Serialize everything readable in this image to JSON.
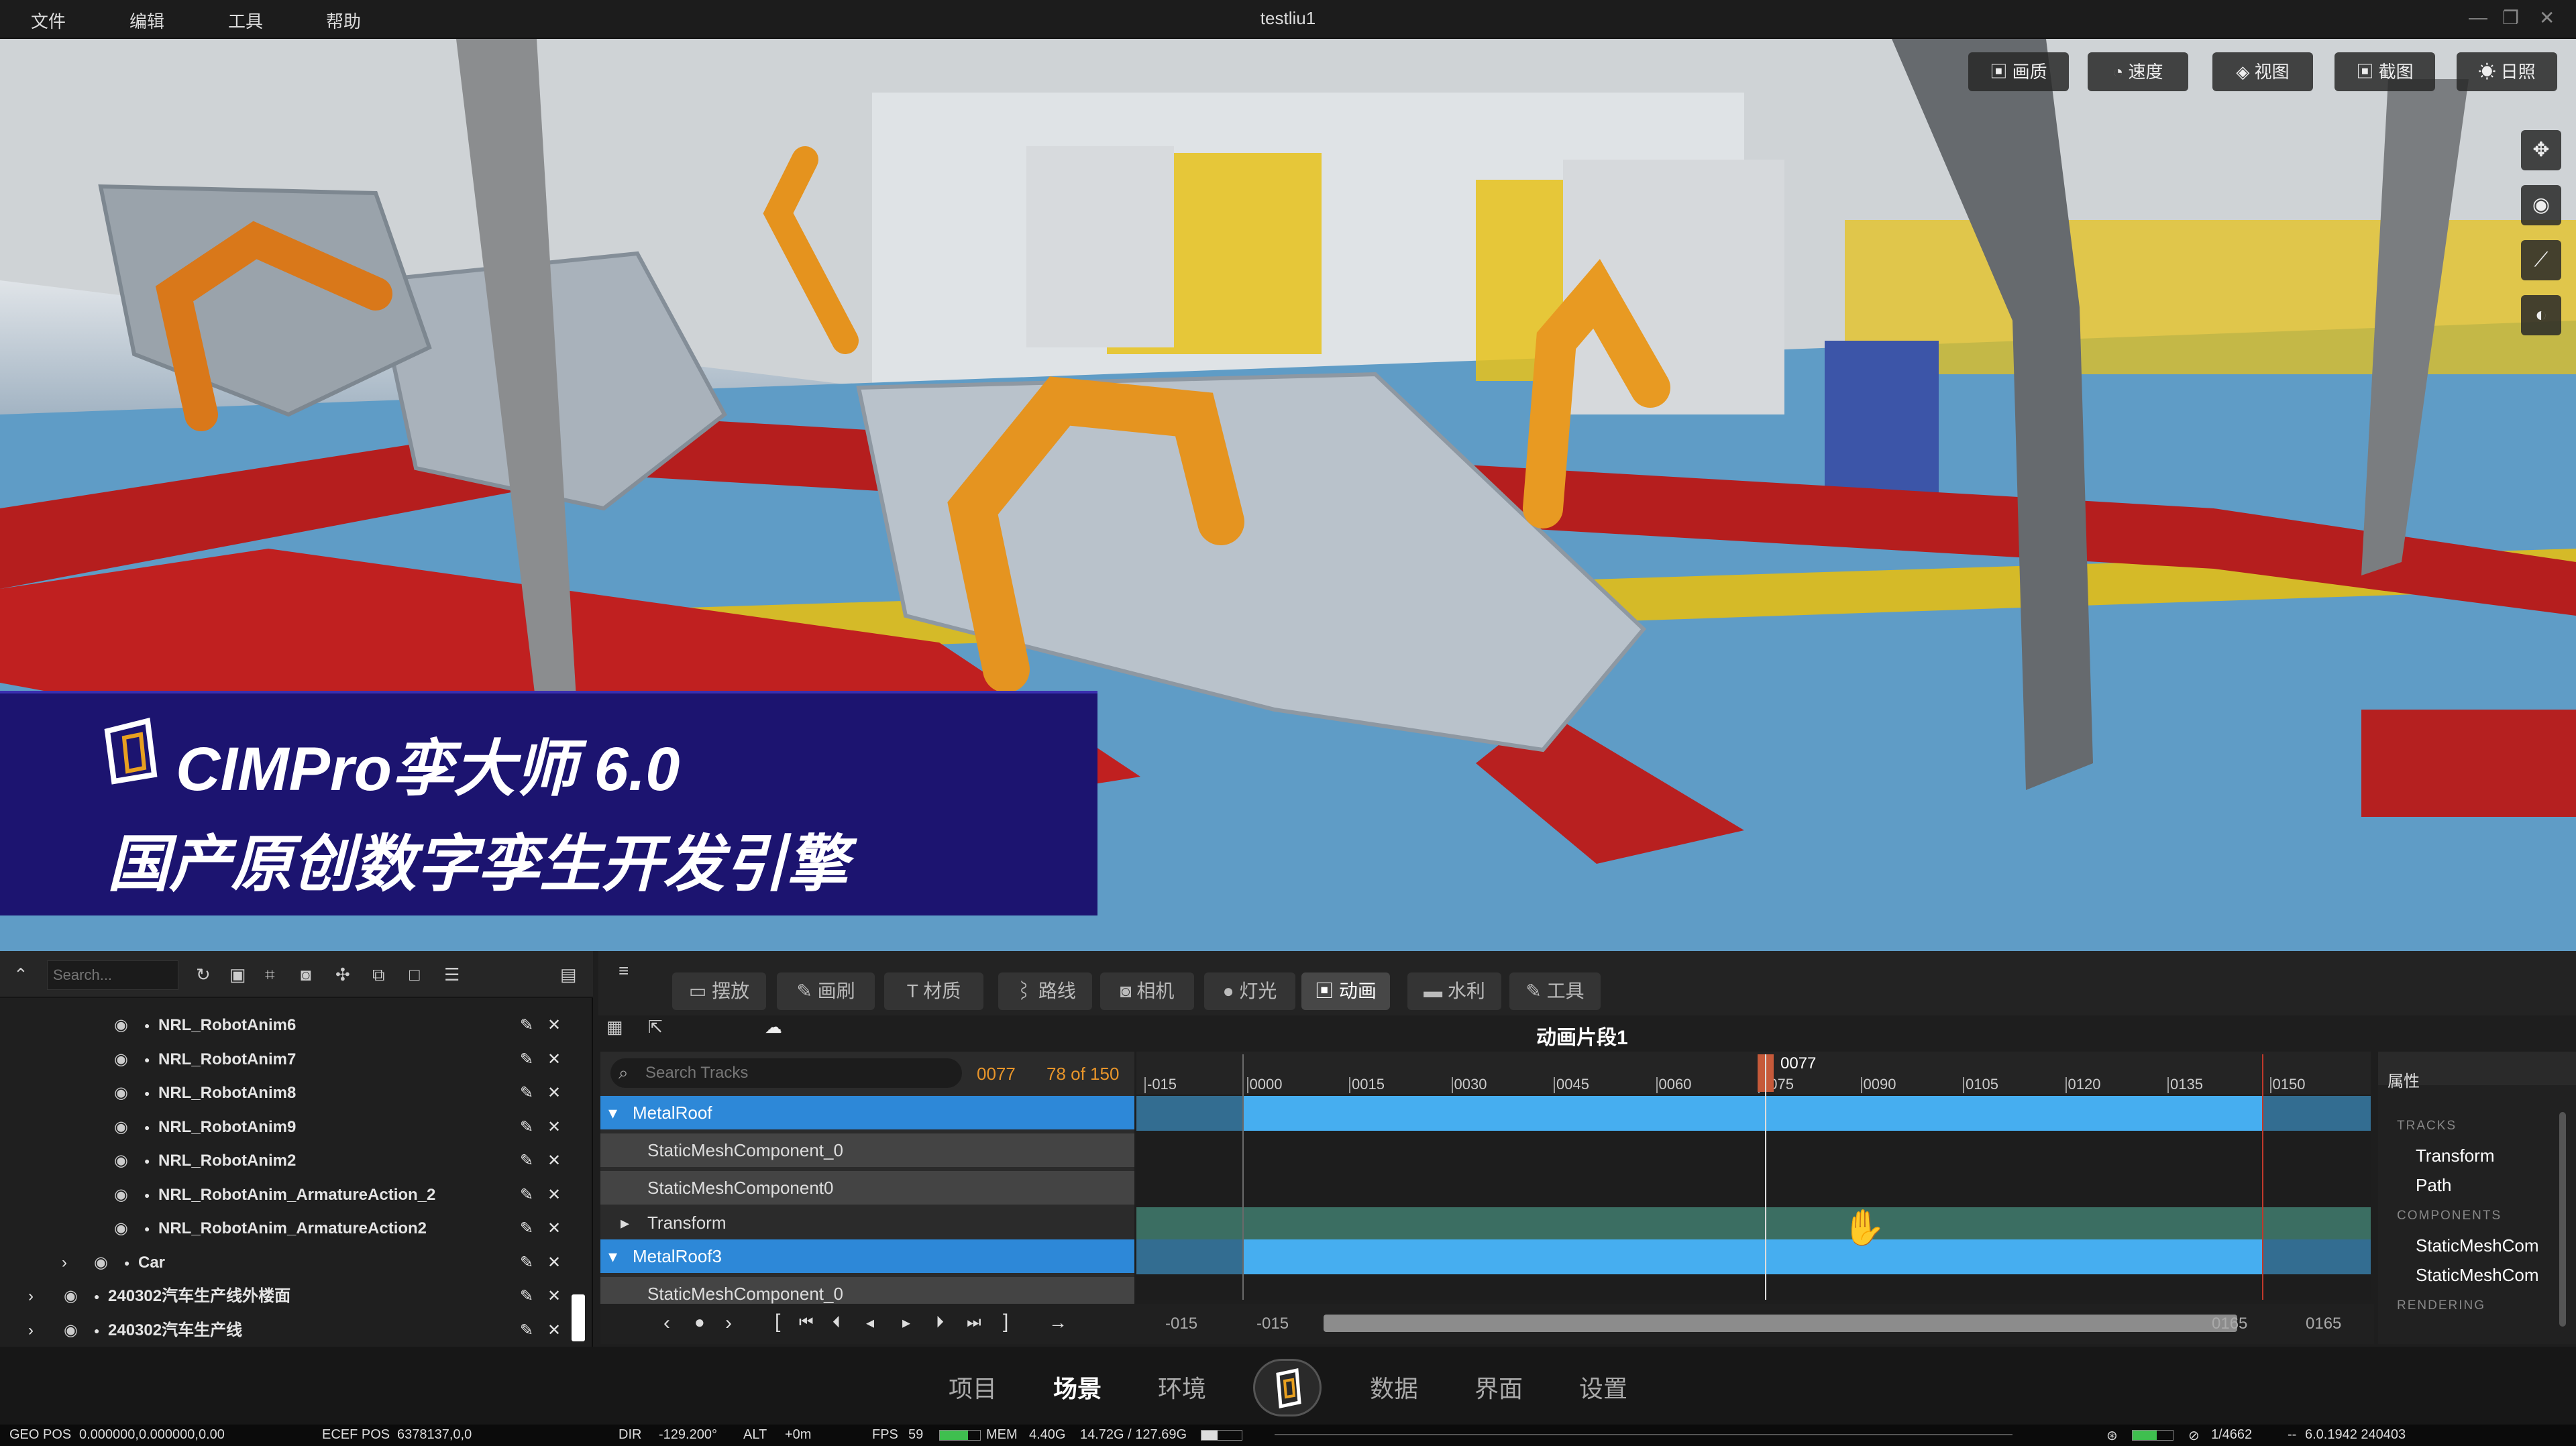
{
  "menubar": {
    "items": [
      "文件",
      "编辑",
      "工具",
      "帮助"
    ],
    "title": "testliu1"
  },
  "viewport_toolbar": [
    "画质",
    "速度",
    "视图",
    "截图",
    "日照"
  ],
  "banner": {
    "line1": "CIMPro孪大师 6.0",
    "line2": "国产原创数字孪生开发引擎"
  },
  "outliner": {
    "search_placeholder": "Search...",
    "rows": [
      {
        "label": "NRL_RobotAnim6",
        "indent": 2
      },
      {
        "label": "NRL_RobotAnim7",
        "indent": 2
      },
      {
        "label": "NRL_RobotAnim8",
        "indent": 2
      },
      {
        "label": "NRL_RobotAnim9",
        "indent": 2
      },
      {
        "label": "NRL_RobotAnim2",
        "indent": 2
      },
      {
        "label": "NRL_RobotAnim_ArmatureAction_2",
        "indent": 2
      },
      {
        "label": "NRL_RobotAnim_ArmatureAction2",
        "indent": 2
      },
      {
        "label": "Car",
        "indent": 1
      },
      {
        "label": "240302汽车生产线外楼面",
        "indent": 0
      },
      {
        "label": "240302汽车生产线",
        "indent": 0
      }
    ]
  },
  "tabs": [
    "摆放",
    "画刷",
    "材质",
    "路线",
    "相机",
    "灯光",
    "动画",
    "水利",
    "工具"
  ],
  "active_tab": "动画",
  "animation": {
    "clip_title": "动画片段1",
    "search_placeholder": "Search Tracks",
    "frame": "0077",
    "frame_count": "78 of 150",
    "ticks": [
      "-015",
      "0000",
      "0015",
      "0030",
      "0045",
      "0060",
      "0075",
      "0090",
      "0105",
      "0120",
      "0135",
      "0150"
    ],
    "playhead": "0077",
    "tracks": [
      {
        "label": "MetalRoof",
        "selected": true
      },
      {
        "label": "StaticMeshComponent_0",
        "selected": false
      },
      {
        "label": "StaticMeshComponent0",
        "selected": false
      },
      {
        "label": "Transform",
        "selected": false
      },
      {
        "label": "MetalRoof3",
        "selected": true
      },
      {
        "label": "StaticMeshComponent_0",
        "selected": false
      }
    ],
    "range_start": "-015",
    "range_start2": "-015",
    "range_end": "0165",
    "range_end2": "0165"
  },
  "properties": {
    "title": "属性",
    "sections": {
      "tracks": "TRACKS",
      "components": "COMPONENTS",
      "rendering": "RENDERING"
    },
    "tracks": [
      "Transform",
      "Path"
    ],
    "components": [
      "StaticMeshCom",
      "StaticMeshCom"
    ]
  },
  "nav": [
    "项目",
    "场景",
    "环境",
    "数据",
    "界面",
    "设置"
  ],
  "active_nav": "场景",
  "status": {
    "geo_label": "GEO POS",
    "geo": "0.000000,0.000000,0.00",
    "ecef_label": "ECEF POS",
    "ecef": "6378137,0,0",
    "dir_label": "DIR",
    "dir": "-129.200°",
    "alt_label": "ALT",
    "alt": "+0m",
    "fps_label": "FPS",
    "fps": "59",
    "mem_label": "MEM",
    "mem": "4.40G",
    "gpu": "14.72G / 127.69G",
    "objects": "1/4662",
    "version": "6.0.1942 240403"
  }
}
